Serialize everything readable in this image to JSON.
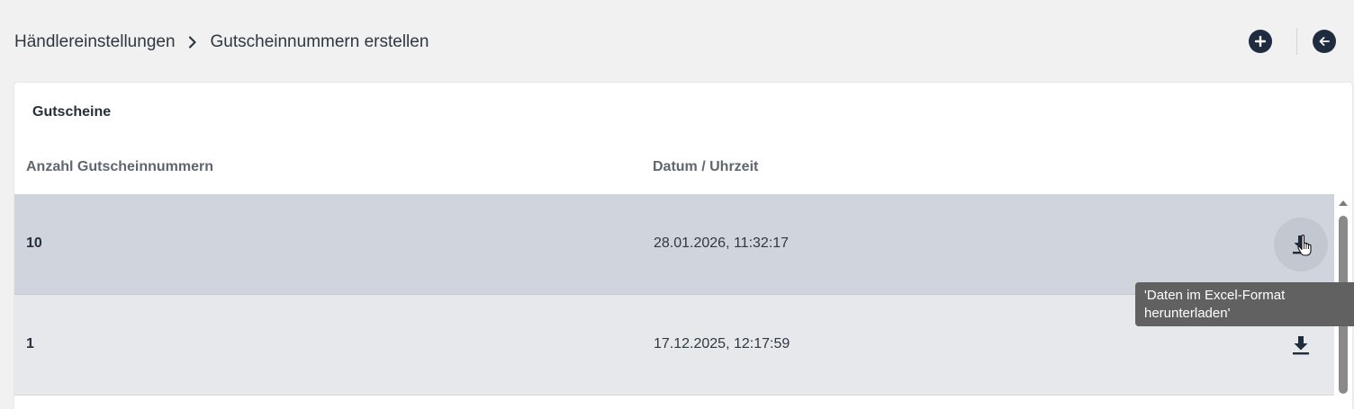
{
  "breadcrumb": {
    "parent": "Händlereinstellungen",
    "current": "Gutscheinnummern erstellen"
  },
  "header": {
    "add_icon": "plus-circle-icon",
    "back_icon": "arrow-left-circle-icon"
  },
  "card": {
    "title": "Gutscheine",
    "columns": {
      "quantity": "Anzahl Gutscheinnummern",
      "datetime": "Datum / Uhrzeit"
    },
    "rows": [
      {
        "quantity": "10",
        "datetime": "28.01.2026, 11:32:17",
        "action_icon": "download-icon",
        "state": "hovered"
      },
      {
        "quantity": "1",
        "datetime": "17.12.2025, 12:17:59",
        "action_icon": "download-icon",
        "state": "default"
      }
    ]
  },
  "tooltip": {
    "line1": "'Daten im Excel-Format",
    "line2": "herunterladen'"
  },
  "colors": {
    "background": "#f1f1f1",
    "accent": "#1f2b3f",
    "row_hover": "#d0d5dd",
    "row_default": "#e6e8ec",
    "tooltip_bg": "#616161"
  }
}
